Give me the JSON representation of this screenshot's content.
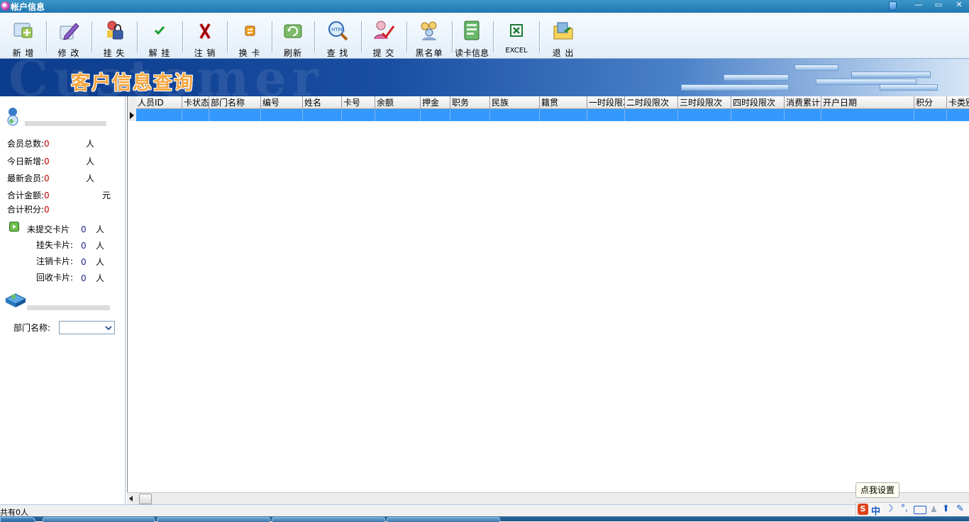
{
  "window": {
    "title": "帐户信息",
    "min_label": "—",
    "max_label": "▭",
    "close_label": "✕"
  },
  "toolbar": {
    "items": [
      {
        "label": "新 增",
        "icon": "add-card-icon"
      },
      {
        "label": "修 改",
        "icon": "edit-pen-icon"
      },
      {
        "label": "挂 失",
        "icon": "lock-person-icon"
      },
      {
        "label": "解 挂",
        "icon": "check-icon"
      },
      {
        "label": "注 销",
        "icon": "x-cancel-icon"
      },
      {
        "label": "换 卡",
        "icon": "swap-card-icon"
      },
      {
        "label": "刷新",
        "icon": "refresh-icon"
      },
      {
        "label": "查 找",
        "icon": "search-html-icon"
      },
      {
        "label": "提 交",
        "icon": "submit-person-icon"
      },
      {
        "label": "黑名单",
        "icon": "blacklist-group-icon"
      },
      {
        "label": "读卡信息",
        "icon": "read-card-icon"
      },
      {
        "label": "EXCEL",
        "icon": "excel-icon"
      },
      {
        "label": "退 出",
        "icon": "exit-folder-icon"
      }
    ]
  },
  "banner": {
    "title": "客户信息查询",
    "watermark": "Customer"
  },
  "left_panel": {
    "stats": [
      {
        "label": "会员总数:",
        "value": "0",
        "unit": "人"
      },
      {
        "label": "今日新增:",
        "value": "0",
        "unit": "人"
      },
      {
        "label": "最新会员:",
        "value": "0",
        "unit": "人"
      },
      {
        "label": "合计金额:",
        "value": "0",
        "unit": "元"
      },
      {
        "label": "合计积分:",
        "value": "0",
        "unit": ""
      }
    ],
    "cards": [
      {
        "label": "未提交卡片",
        "value": "0",
        "unit": "人"
      },
      {
        "label": "挂失卡片:",
        "value": "0",
        "unit": "人"
      },
      {
        "label": "注销卡片:",
        "value": "0",
        "unit": "人"
      },
      {
        "label": "回收卡片:",
        "value": "0",
        "unit": "人"
      }
    ],
    "department_label": "部门名称:",
    "department_value": ""
  },
  "grid": {
    "columns": [
      "人员ID",
      "卡状态",
      "部门名称",
      "编号",
      "姓名",
      "卡号",
      "余额",
      "押金",
      "职务",
      "民族",
      "籍贯",
      "一时段限次",
      "二时段限次",
      "三时段限次",
      "四时段限次",
      "消费累计",
      "开户日期",
      "积分",
      "卡类别"
    ],
    "rows": []
  },
  "status": {
    "text": "共有0人"
  },
  "ime": {
    "tooltip": "点我设置",
    "mode": "中"
  },
  "colors": {
    "titlebar": "#2a86bd",
    "selection": "#3399ff",
    "value_red": "#c00000"
  }
}
